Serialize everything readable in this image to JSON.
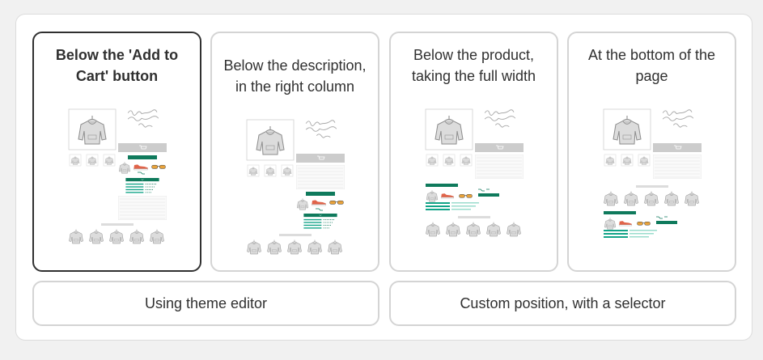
{
  "placement_options": [
    {
      "label": "Below the 'Add to Cart' button",
      "selected": true
    },
    {
      "label": "Below the description, in the right column",
      "selected": false
    },
    {
      "label": "Below the product, taking the full width",
      "selected": false
    },
    {
      "label": "At the bottom of the page",
      "selected": false
    }
  ],
  "buttons": {
    "theme_editor": "Using theme editor",
    "custom_selector": "Custom position, with a selector"
  },
  "icons": [
    "hoodie-icon",
    "sneaker-icon",
    "sunglasses-icon",
    "cart-icon"
  ],
  "colors": {
    "selected_border": "#303030",
    "default_border": "#d4d4d4",
    "accent_green": "#0f7a5c",
    "sneaker_red": "#e0644a",
    "sunglasses_orange": "#e8a23a"
  }
}
